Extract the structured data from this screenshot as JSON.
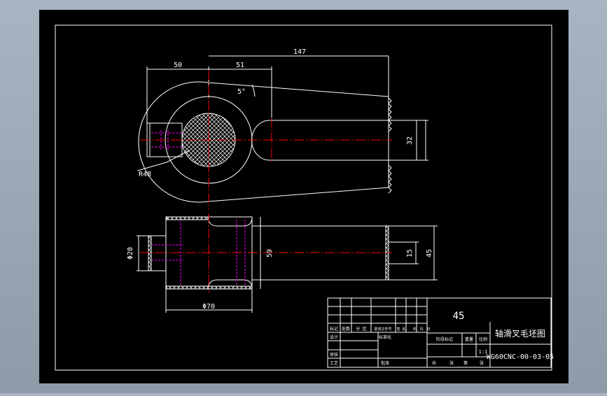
{
  "drawing": {
    "dimensions": {
      "left_length": "50",
      "center_offset": "51",
      "total_length": "147",
      "taper_angle": "5°",
      "eye_diameter": "R48",
      "shaft_diameter": "32",
      "hub_height": "59",
      "bolt_diameter": "Φ28",
      "hub_width": "Φ70",
      "slot_width": "15",
      "stem_height": "45"
    }
  },
  "title_block": {
    "material": "45",
    "part_name": "轴滑叉毛坯图",
    "drawing_number": "WG60CNC-00-03-05",
    "scale": "1:1",
    "header_labels": [
      "标记",
      "处数",
      "分 区",
      "更改文件号",
      "签 名",
      "年、月、日"
    ],
    "row_labels": [
      "设计",
      "审核",
      "工艺"
    ],
    "standardization": "标准化",
    "approval": "批准",
    "stage_headers": [
      "阶段标记",
      "重量",
      "比例"
    ],
    "sheet_footer": [
      "共",
      "张",
      "第",
      "张"
    ]
  },
  "colors": {
    "background": "#000000",
    "outline": "#ffffff",
    "centerline": "#ff0000",
    "hidden": "#ff00ff"
  }
}
